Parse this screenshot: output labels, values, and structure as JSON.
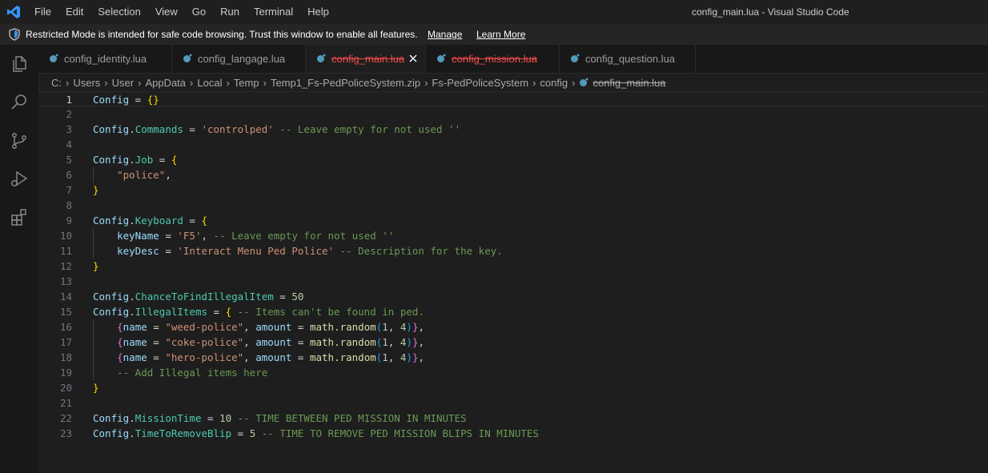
{
  "menu": [
    "File",
    "Edit",
    "Selection",
    "View",
    "Go",
    "Run",
    "Terminal",
    "Help"
  ],
  "window_title": "config_main.lua - Visual Studio Code",
  "restricted": {
    "message": "Restricted Mode is intended for safe code browsing. Trust this window to enable all features.",
    "manage": "Manage",
    "learn_more": "Learn More"
  },
  "activity_icons": [
    "files-icon",
    "search-icon",
    "source-control-icon",
    "run-debug-icon",
    "extensions-icon"
  ],
  "tabs": [
    {
      "label": "config_identity.lua",
      "active": false,
      "struck": false
    },
    {
      "label": "config_langage.lua",
      "active": false,
      "struck": false
    },
    {
      "label": "config_main.lua",
      "active": true,
      "struck": true
    },
    {
      "label": "config_mission.lua",
      "active": false,
      "struck": true
    },
    {
      "label": "config_question.lua",
      "active": false,
      "struck": false
    }
  ],
  "breadcrumb": [
    "C:",
    "Users",
    "User",
    "AppData",
    "Local",
    "Temp",
    "Temp1_Fs-PedPoliceSystem.zip",
    "Fs-PedPoliceSystem",
    "config",
    "config_main.lua"
  ],
  "colors": {
    "accent": "#007acc",
    "lua_icon": "#519aba",
    "deleted": "#f14c4c"
  },
  "code_lines": [
    [
      [
        "var",
        "Config"
      ],
      [
        "op",
        " = "
      ],
      [
        "b1",
        "{}"
      ]
    ],
    [],
    [
      [
        "var",
        "Config"
      ],
      [
        "op",
        "."
      ],
      [
        "field",
        "Commands"
      ],
      [
        "op",
        " = "
      ],
      [
        "str",
        "'controlped'"
      ],
      [
        "cmt",
        " -- Leave empty for not used ''"
      ]
    ],
    [],
    [
      [
        "var",
        "Config"
      ],
      [
        "op",
        "."
      ],
      [
        "field",
        "Job"
      ],
      [
        "op",
        " = "
      ],
      [
        "b1",
        "{"
      ]
    ],
    [
      [
        "op",
        "    "
      ],
      [
        "str",
        "\"police\""
      ],
      [
        "op",
        ","
      ]
    ],
    [
      [
        "b1",
        "}"
      ]
    ],
    [],
    [
      [
        "var",
        "Config"
      ],
      [
        "op",
        "."
      ],
      [
        "field",
        "Keyboard"
      ],
      [
        "op",
        " = "
      ],
      [
        "b1",
        "{"
      ]
    ],
    [
      [
        "op",
        "    "
      ],
      [
        "var",
        "keyName"
      ],
      [
        "op",
        " = "
      ],
      [
        "str",
        "'F5'"
      ],
      [
        "op",
        ","
      ],
      [
        "cmt",
        " -- Leave empty for not used ''"
      ]
    ],
    [
      [
        "op",
        "    "
      ],
      [
        "var",
        "keyDesc"
      ],
      [
        "op",
        " = "
      ],
      [
        "str",
        "'Interact Menu Ped Police'"
      ],
      [
        "cmt",
        " -- Description for the key."
      ]
    ],
    [
      [
        "b1",
        "}"
      ]
    ],
    [],
    [
      [
        "var",
        "Config"
      ],
      [
        "op",
        "."
      ],
      [
        "field",
        "ChanceToFindIllegalItem"
      ],
      [
        "op",
        " = "
      ],
      [
        "num",
        "50"
      ]
    ],
    [
      [
        "var",
        "Config"
      ],
      [
        "op",
        "."
      ],
      [
        "field",
        "IllegalItems"
      ],
      [
        "op",
        " = "
      ],
      [
        "b1",
        "{"
      ],
      [
        "cmt",
        " -- Items can't be found in ped."
      ]
    ],
    [
      [
        "op",
        "    "
      ],
      [
        "b2",
        "{"
      ],
      [
        "var",
        "name"
      ],
      [
        "op",
        " = "
      ],
      [
        "str",
        "\"weed-police\""
      ],
      [
        "op",
        ", "
      ],
      [
        "var",
        "amount"
      ],
      [
        "op",
        " = "
      ],
      [
        "fn",
        "math.random"
      ],
      [
        "b3",
        "("
      ],
      [
        "num",
        "1"
      ],
      [
        "op",
        ", "
      ],
      [
        "num",
        "4"
      ],
      [
        "b3",
        ")"
      ],
      [
        "b2",
        "}"
      ],
      [
        "op",
        ","
      ]
    ],
    [
      [
        "op",
        "    "
      ],
      [
        "b2",
        "{"
      ],
      [
        "var",
        "name"
      ],
      [
        "op",
        " = "
      ],
      [
        "str",
        "\"coke-police\""
      ],
      [
        "op",
        ", "
      ],
      [
        "var",
        "amount"
      ],
      [
        "op",
        " = "
      ],
      [
        "fn",
        "math.random"
      ],
      [
        "b3",
        "("
      ],
      [
        "num",
        "1"
      ],
      [
        "op",
        ", "
      ],
      [
        "num",
        "4"
      ],
      [
        "b3",
        ")"
      ],
      [
        "b2",
        "}"
      ],
      [
        "op",
        ","
      ]
    ],
    [
      [
        "op",
        "    "
      ],
      [
        "b2",
        "{"
      ],
      [
        "var",
        "name"
      ],
      [
        "op",
        " = "
      ],
      [
        "str",
        "\"hero-police\""
      ],
      [
        "op",
        ", "
      ],
      [
        "var",
        "amount"
      ],
      [
        "op",
        " = "
      ],
      [
        "fn",
        "math.random"
      ],
      [
        "b3",
        "("
      ],
      [
        "num",
        "1"
      ],
      [
        "op",
        ", "
      ],
      [
        "num",
        "4"
      ],
      [
        "b3",
        ")"
      ],
      [
        "b2",
        "}"
      ],
      [
        "op",
        ","
      ]
    ],
    [
      [
        "op",
        "    "
      ],
      [
        "cmt",
        "-- Add Illegal items here"
      ]
    ],
    [
      [
        "b1",
        "}"
      ]
    ],
    [],
    [
      [
        "var",
        "Config"
      ],
      [
        "op",
        "."
      ],
      [
        "field",
        "MissionTime"
      ],
      [
        "op",
        " = "
      ],
      [
        "num",
        "10"
      ],
      [
        "cmt",
        " -- TIME BETWEEN PED MISSION IN MINUTES"
      ]
    ],
    [
      [
        "var",
        "Config"
      ],
      [
        "op",
        "."
      ],
      [
        "field",
        "TimeToRemoveBlip"
      ],
      [
        "op",
        " = "
      ],
      [
        "num",
        "5"
      ],
      [
        "cmt",
        " -- TIME TO REMOVE PED MISSION BLIPS IN MINUTES"
      ]
    ]
  ]
}
